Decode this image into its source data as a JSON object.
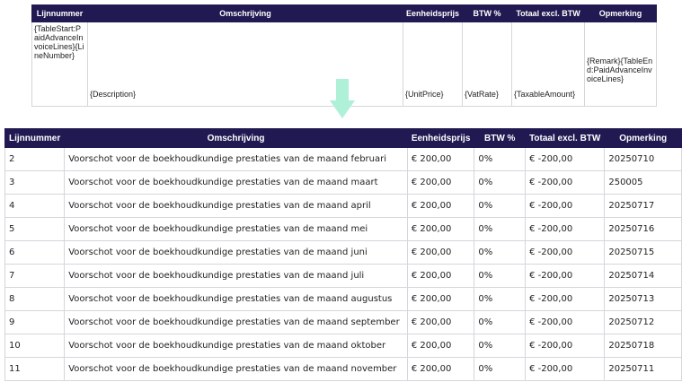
{
  "template_table": {
    "headers": {
      "line_number": "Lijnnummer",
      "description": "Omschrijving",
      "unit_price": "Eenheidsprijs",
      "vat": "BTW %",
      "total_excl": "Totaal excl. BTW",
      "remark": "Opmerking"
    },
    "row": {
      "line_number": "{TableStart:PaidAdvanceInvoiceLines}{LineNumber}",
      "description": "{Description}",
      "unit_price": "{UnitPrice}",
      "vat": "{VatRate}",
      "total_excl": "{TaxableAmount}",
      "remark": "{Remark}{TableEnd:PaidAdvanceInvoiceLines}"
    }
  },
  "arrow": {
    "icon": "down-arrow-icon",
    "color": "#aef0d8"
  },
  "result_table": {
    "headers": {
      "line_number": "Lijnnummer",
      "description": "Omschrijving",
      "unit_price": "Eenheidsprijs",
      "vat": "BTW %",
      "total_excl": "Totaal excl. BTW",
      "remark": "Opmerking"
    },
    "rows": [
      {
        "line_number": "2",
        "description": "Voorschot voor de boekhoudkundige prestaties van de maand februari",
        "unit_price": "€ 200,00",
        "vat": "0%",
        "total_excl": "€ -200,00",
        "remark": "20250710"
      },
      {
        "line_number": "3",
        "description": "Voorschot voor de boekhoudkundige prestaties van de maand maart",
        "unit_price": "€ 200,00",
        "vat": "0%",
        "total_excl": "€ -200,00",
        "remark": "250005"
      },
      {
        "line_number": "4",
        "description": "Voorschot voor de boekhoudkundige prestaties van de maand april",
        "unit_price": "€ 200,00",
        "vat": "0%",
        "total_excl": "€ -200,00",
        "remark": "20250717"
      },
      {
        "line_number": "5",
        "description": "Voorschot voor de boekhoudkundige prestaties van de maand mei",
        "unit_price": "€ 200,00",
        "vat": "0%",
        "total_excl": "€ -200,00",
        "remark": "20250716"
      },
      {
        "line_number": "6",
        "description": "Voorschot voor de boekhoudkundige prestaties van de maand juni",
        "unit_price": "€ 200,00",
        "vat": "0%",
        "total_excl": "€ -200,00",
        "remark": "20250715"
      },
      {
        "line_number": "7",
        "description": "Voorschot voor de boekhoudkundige prestaties van de maand juli",
        "unit_price": "€ 200,00",
        "vat": "0%",
        "total_excl": "€ -200,00",
        "remark": "20250714"
      },
      {
        "line_number": "8",
        "description": "Voorschot voor de boekhoudkundige prestaties van de maand augustus",
        "unit_price": "€ 200,00",
        "vat": "0%",
        "total_excl": "€ -200,00",
        "remark": "20250713"
      },
      {
        "line_number": "9",
        "description": "Voorschot voor de boekhoudkundige prestaties van de maand september",
        "unit_price": "€ 200,00",
        "vat": "0%",
        "total_excl": "€ -200,00",
        "remark": "20250712"
      },
      {
        "line_number": "10",
        "description": "Voorschot voor de boekhoudkundige prestaties van de maand oktober",
        "unit_price": "€ 200,00",
        "vat": "0%",
        "total_excl": "€ -200,00",
        "remark": "20250718"
      },
      {
        "line_number": "11",
        "description": "Voorschot voor de boekhoudkundige prestaties van de maand november",
        "unit_price": "€ 200,00",
        "vat": "0%",
        "total_excl": "€ -200,00",
        "remark": "20250711"
      }
    ]
  }
}
